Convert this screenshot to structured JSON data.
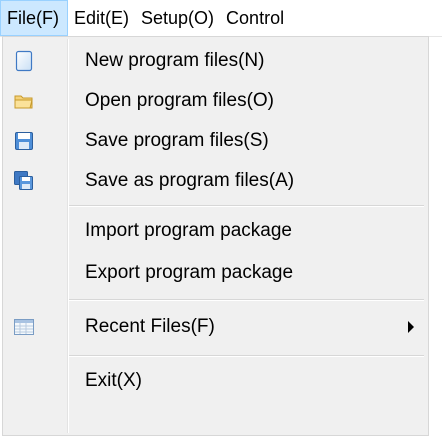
{
  "menubar": {
    "items": [
      {
        "label": "File(F)"
      },
      {
        "label": "Edit(E)"
      },
      {
        "label": "Setup(O)"
      },
      {
        "label": "Control"
      }
    ]
  },
  "file_menu": {
    "items": [
      {
        "label": "New program files(N)",
        "icon": "new-file-icon"
      },
      {
        "label": "Open program files(O)",
        "icon": "open-folder-icon"
      },
      {
        "label": "Save program files(S)",
        "icon": "save-icon"
      },
      {
        "label": "Save as program files(A)",
        "icon": "save-as-icon"
      },
      {
        "label": "Import program package",
        "icon": ""
      },
      {
        "label": "Export program package",
        "icon": ""
      },
      {
        "label": "Recent Files(F)",
        "icon": "recent-files-icon"
      },
      {
        "label": "Exit(X)",
        "icon": ""
      }
    ]
  },
  "colors": {
    "menubar_active_bg": "#cce8ff",
    "menubar_active_border": "#99d1ff",
    "dropdown_bg": "#f0f0f0"
  }
}
